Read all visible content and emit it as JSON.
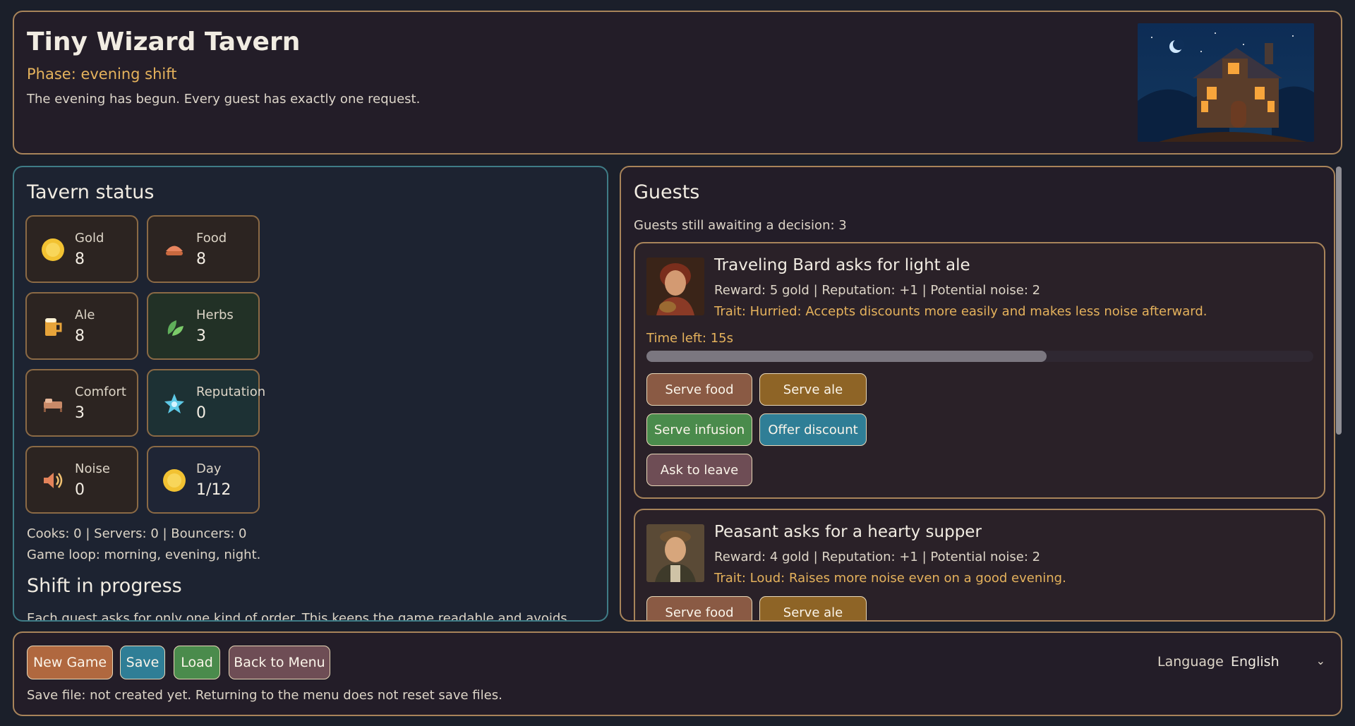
{
  "header": {
    "title": "Tiny Wizard Tavern",
    "phase": "Phase: evening shift",
    "description": "The evening has begun. Every guest has exactly one request."
  },
  "status": {
    "heading": "Tavern status",
    "stats": [
      {
        "label": "Gold",
        "value": "8",
        "icon": "gold-coin-icon"
      },
      {
        "label": "Food",
        "value": "8",
        "icon": "food-bun-icon"
      },
      {
        "label": "Ale",
        "value": "8",
        "icon": "ale-mug-icon"
      },
      {
        "label": "Herbs",
        "value": "3",
        "icon": "herb-leaf-icon"
      },
      {
        "label": "Comfort",
        "value": "3",
        "icon": "bed-icon"
      },
      {
        "label": "Reputation",
        "value": "0",
        "icon": "star-icon"
      },
      {
        "label": "Noise",
        "value": "0",
        "icon": "speaker-icon"
      },
      {
        "label": "Day",
        "value": "1/12",
        "icon": "sun-icon"
      }
    ],
    "staff": "Cooks: 0 | Servers: 0 | Bouncers: 0",
    "loop": "Game loop: morning, evening, night.",
    "shift_heading": "Shift in progress",
    "shift_text": "Each guest asks for only one kind of order. This keeps the game readable and avoids"
  },
  "guests": {
    "heading": "Guests",
    "awaiting": "Guests still awaiting a decision: 3",
    "list": [
      {
        "title": "Traveling Bard asks for light ale",
        "meta": "Reward: 5 gold | Reputation: +1 | Potential noise: 2",
        "trait": "Trait: Hurried: Accepts discounts more easily and makes less noise afterward.",
        "time_left": "Time left: 15s",
        "time_fraction": 0.6,
        "buttons": [
          "Serve food",
          "Serve ale",
          "Serve infusion",
          "Offer discount",
          "Ask to leave"
        ]
      },
      {
        "title": "Peasant asks for a hearty supper",
        "meta": "Reward: 4 gold | Reputation: +1 | Potential noise: 2",
        "trait": "Trait: Loud: Raises more noise even on a good evening.",
        "buttons": [
          "Serve food",
          "Serve ale"
        ]
      }
    ]
  },
  "footer": {
    "new_game": "New Game",
    "save": "Save",
    "load": "Load",
    "back": "Back to Menu",
    "note": "Save file: not created yet. Returning to the menu does not reset save files.",
    "language_label": "Language",
    "language_value": "English"
  },
  "colors": {
    "accent_gold": "#e5b25c",
    "border": "#a8845a",
    "status_border": "#3f7c86"
  }
}
